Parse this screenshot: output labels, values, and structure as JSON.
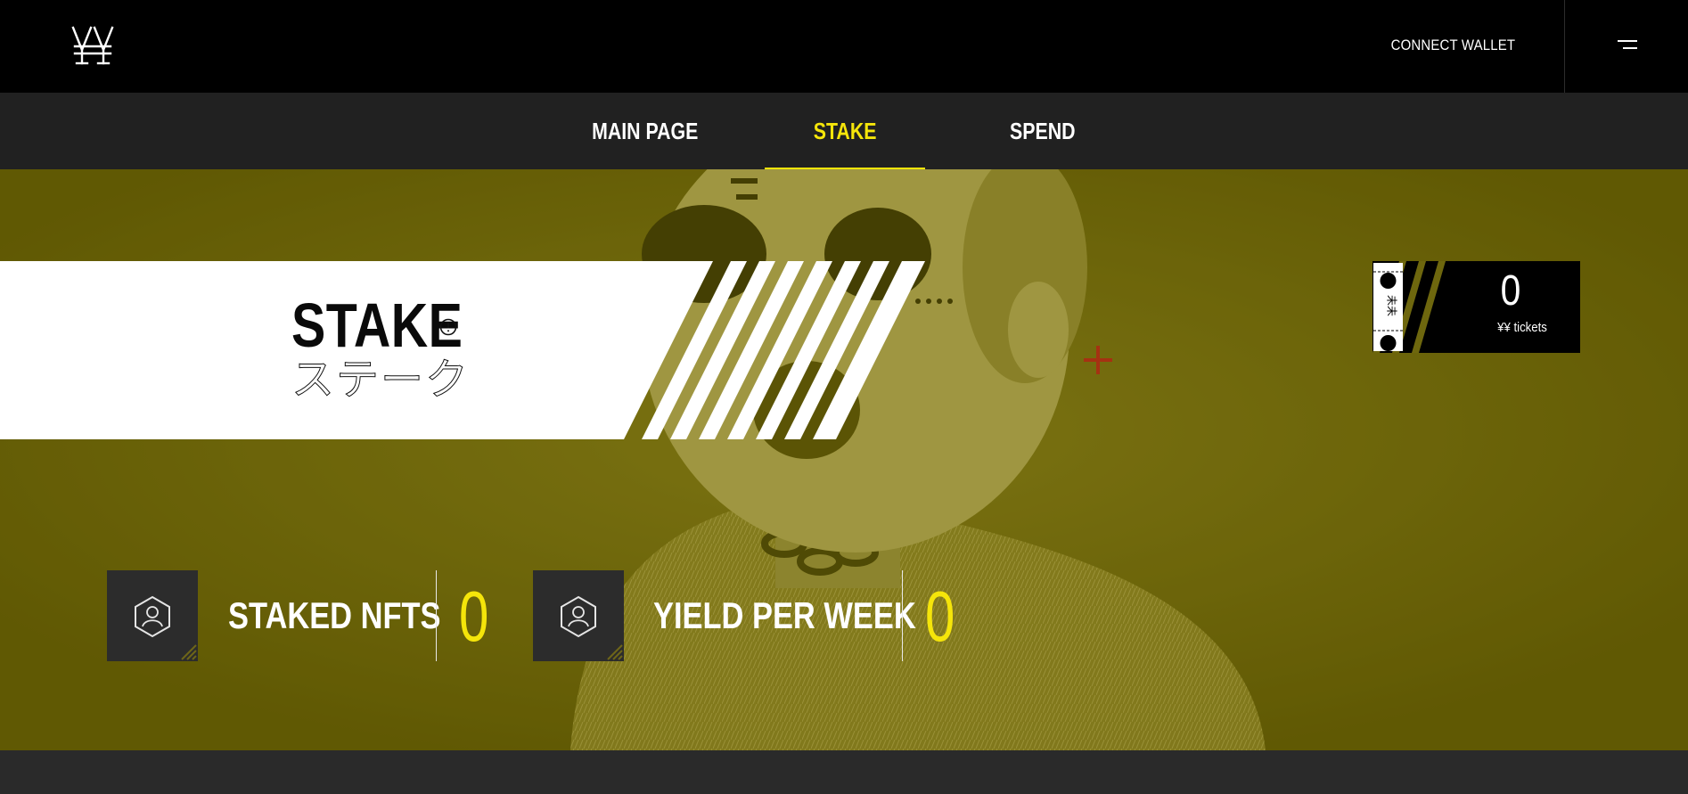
{
  "header": {
    "logo_icon": "yen-logo-icon",
    "connect_label": "CONNECT WALLET",
    "menu_icon": "menu-icon"
  },
  "nav": {
    "items": [
      {
        "label": "MAIN PAGE"
      },
      {
        "label": "STAKE",
        "active": true
      },
      {
        "label": "SPEND"
      }
    ]
  },
  "hero": {
    "title": "STAKE",
    "title_jp": "ステーク",
    "info_icon": "info-icon"
  },
  "ticket": {
    "value": "0",
    "label": "¥¥ tickets",
    "stub_text": "未未"
  },
  "stats": [
    {
      "label": "STAKED NFTS",
      "value": "0",
      "icon": "user-hexagon-icon"
    },
    {
      "label": "YIELD PER WEEK",
      "value": "0",
      "icon": "user-hexagon-icon"
    }
  ],
  "colors": {
    "accent": "#f5e50a",
    "background": "#000000",
    "nav_bg": "#212121",
    "hero_tint": "#5e5708"
  }
}
